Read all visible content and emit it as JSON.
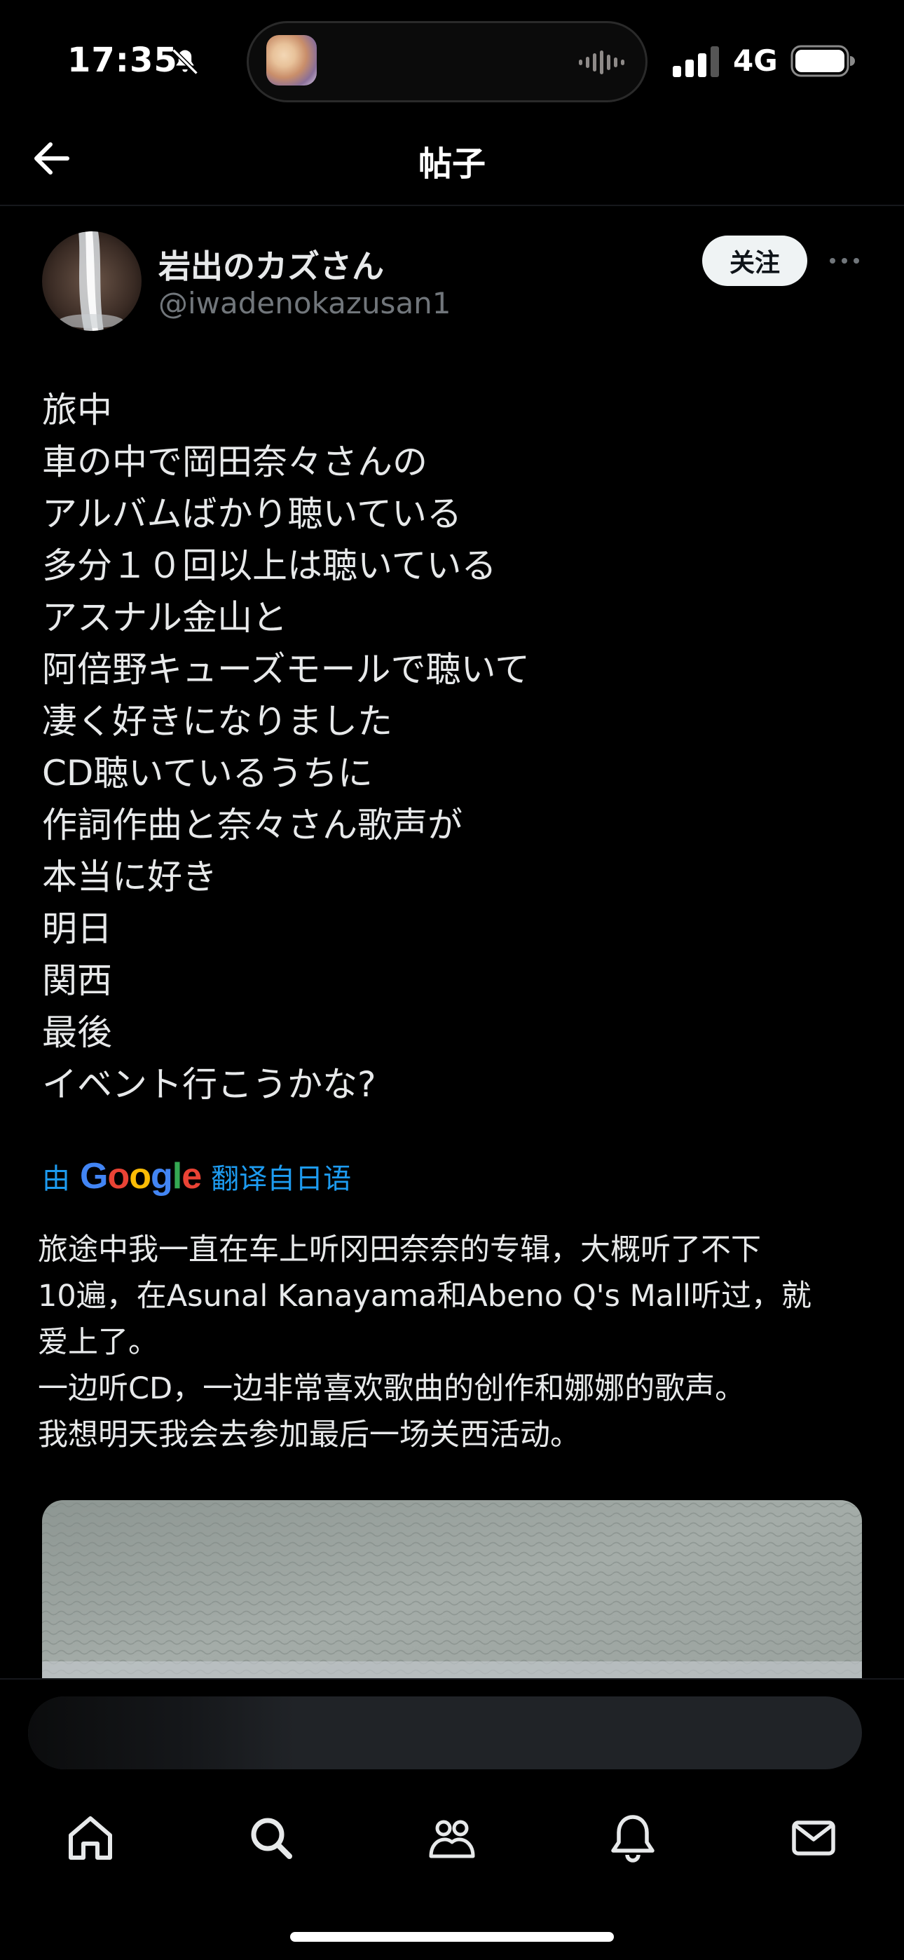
{
  "status_bar": {
    "time": "17:35",
    "network": "4G",
    "icons": [
      "bell-muted-icon",
      "signal-icon",
      "battery-icon",
      "audio-wave-icon"
    ]
  },
  "header": {
    "title": "帖子",
    "back_icon": "arrow-left-icon"
  },
  "post": {
    "author": {
      "name": "岩出のカズさん",
      "handle": "@iwadenokazusan1"
    },
    "follow_label": "关注",
    "lines": [
      "旅中",
      "車の中で岡田奈々さんの",
      "アルバムばかり聴いている",
      "多分１０回以上は聴いている",
      "アスナル金山と",
      "阿倍野キューズモールで聴いて",
      "凄く好きになりました",
      "CD聴いているうちに",
      "作詞作曲と奈々さん歌声が",
      "本当に好き",
      "明日",
      "関西",
      "最後",
      "イベント行こうかな?"
    ],
    "translation_prefix": "由",
    "translation_brand": "Google",
    "translation_suffix": "翻译自日语",
    "translation_lines": [
      "旅途中我一直在车上听冈田奈奈的专辑，大概听了不下",
      "10遍，在Asunal Kanayama和Abeno Q's Mall听过，就",
      "爱上了。",
      "一边听CD，一边非常喜欢歌曲的创作和娜娜的歌声。",
      "我想明天我会去参加最后一场关西活动。"
    ]
  },
  "tabbar": {
    "items": [
      "home-icon",
      "search-icon",
      "communities-icon",
      "notifications-icon",
      "messages-icon"
    ]
  },
  "colors": {
    "background": "#000000",
    "text": "#e7e9ea",
    "muted": "#71767b",
    "link": "#1d9bf0"
  }
}
